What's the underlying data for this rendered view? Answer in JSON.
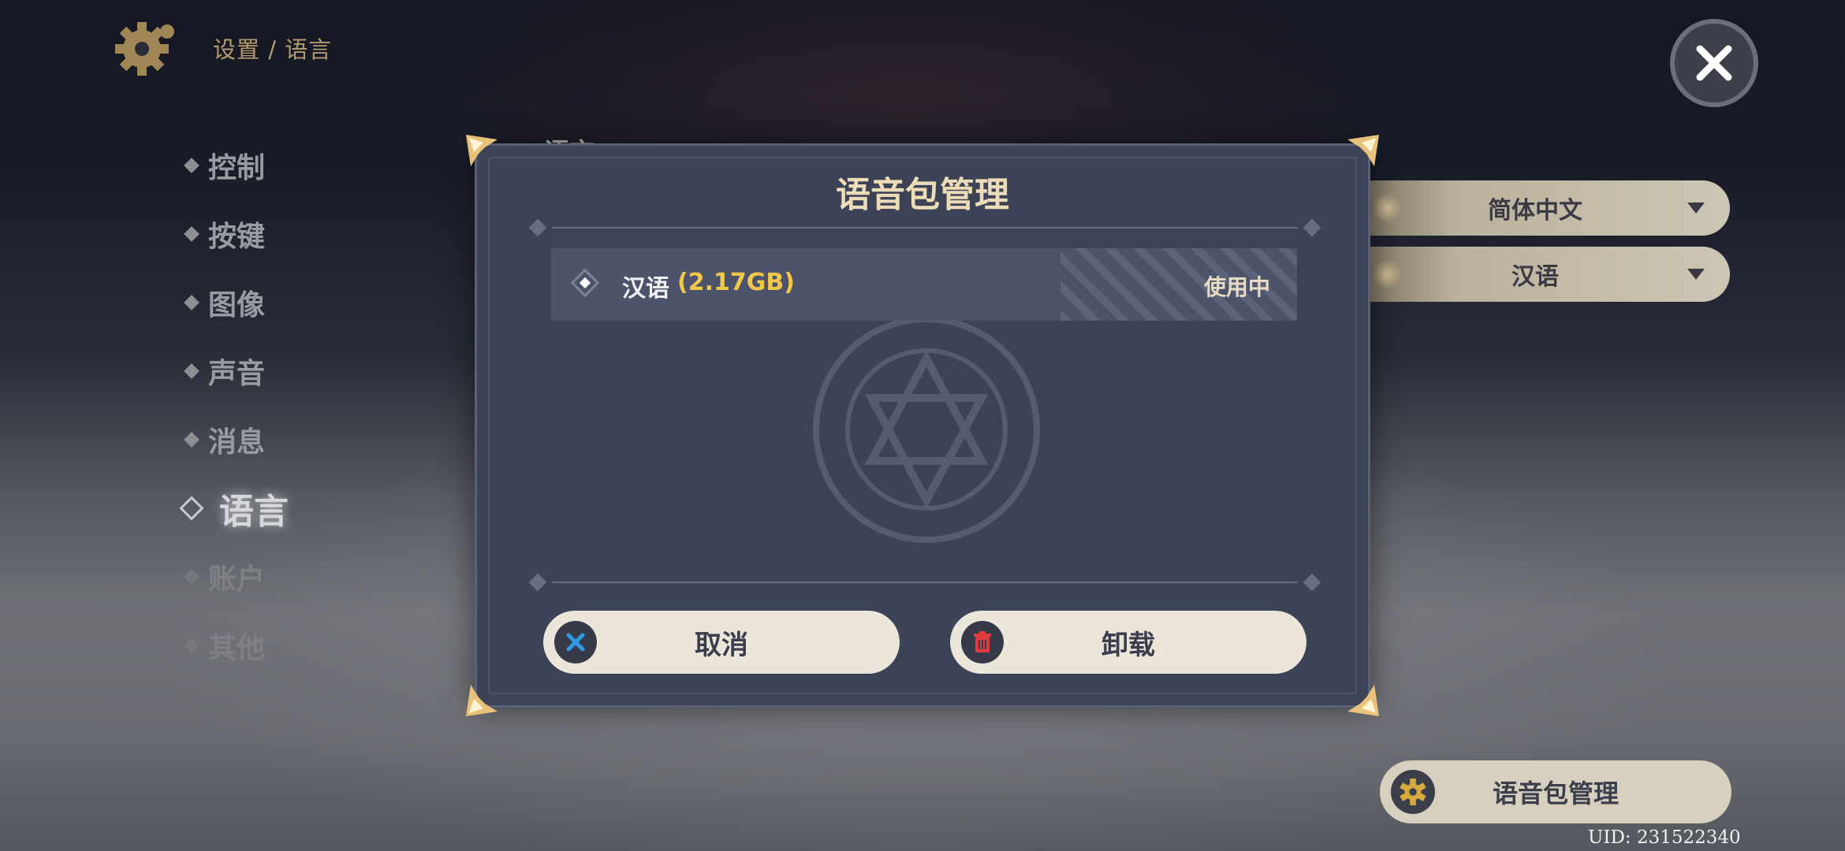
{
  "header": {
    "breadcrumb": "设置 / 语言"
  },
  "sidebar": {
    "items": [
      {
        "label": "控制"
      },
      {
        "label": "按键"
      },
      {
        "label": "图像"
      },
      {
        "label": "声音"
      },
      {
        "label": "消息"
      },
      {
        "label": "语言"
      },
      {
        "label": "账户"
      },
      {
        "label": "其他"
      }
    ],
    "active_index": 5
  },
  "settings": {
    "section_title": "语言",
    "text_language": "简体中文",
    "voice_language": "汉语",
    "manage_button": "语音包管理"
  },
  "uid": "UID: 231522340",
  "modal": {
    "title": "语音包管理",
    "pack": {
      "name": "汉语",
      "size": "(2.17GB)",
      "status": "使用中"
    },
    "cancel_label": "取消",
    "uninstall_label": "卸载"
  },
  "colors": {
    "accent_gold": "#f2c84b",
    "modal_bg": "#3d4357",
    "button_bg": "#ece5d9",
    "cancel_icon": "#2f9be5",
    "delete_icon": "#e23b3b"
  },
  "icons": {
    "settings": "gear-icon",
    "close": "close-icon",
    "cancel": "cancel-x-icon",
    "uninstall": "trash-icon",
    "manage": "gear-icon"
  }
}
